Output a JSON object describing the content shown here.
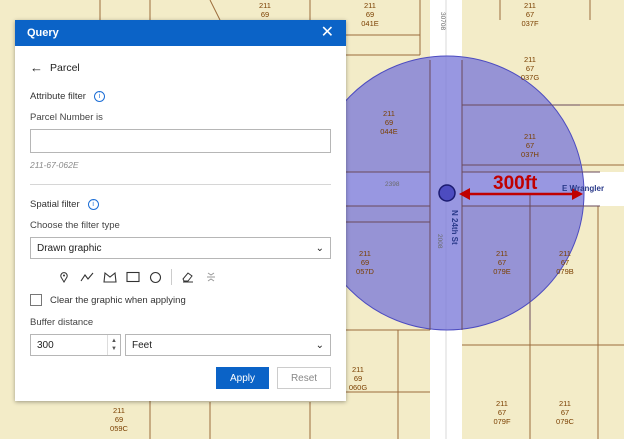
{
  "panel": {
    "title": "Query",
    "back_label": "Parcel",
    "attribute_filter": "Attribute filter",
    "parcel_number_label": "Parcel Number is",
    "parcel_number_value": "",
    "parcel_hint": "211-67-062E",
    "spatial_filter": "Spatial filter",
    "filter_type_label": "Choose the filter type",
    "filter_type_value": "Drawn graphic",
    "clear_label": "Clear the graphic when applying",
    "buffer_label": "Buffer distance",
    "buffer_value": "300",
    "buffer_unit": "Feet",
    "apply_label": "Apply",
    "reset_label": "Reset"
  },
  "draw_tools": [
    "point-icon",
    "polyline-icon",
    "freehand-polygon-icon",
    "rectangle-icon",
    "circle-icon",
    "eraser-icon",
    "collapse-icon"
  ],
  "map": {
    "distance_label": "300ft",
    "streets": {
      "vertical": "N 24th St",
      "horizontal": "E Wrangler",
      "number_top": "30708",
      "number_mid": "2398",
      "number_side": "2008"
    },
    "parcels": [
      {
        "a": "211",
        "b": "69",
        "c": ""
      },
      {
        "a": "211",
        "b": "69",
        "c": "041E"
      },
      {
        "a": "211",
        "b": "67",
        "c": "037F"
      },
      {
        "a": "211",
        "b": "67",
        "c": "037G"
      },
      {
        "a": "211",
        "b": "69",
        "c": "044E"
      },
      {
        "a": "211",
        "b": "67",
        "c": "037H"
      },
      {
        "a": "211",
        "b": "69",
        "c": "057D"
      },
      {
        "a": "211",
        "b": "67",
        "c": "079E"
      },
      {
        "a": "211",
        "b": "67",
        "c": "079B"
      },
      {
        "a": "211",
        "b": "69",
        "c": "060G"
      },
      {
        "a": "211",
        "b": "69",
        "c": "059C"
      },
      {
        "a": "211",
        "b": "67",
        "c": "079F"
      },
      {
        "a": "211",
        "b": "67",
        "c": "079C"
      }
    ],
    "colors": {
      "parcel_fill": "#f3ecc8",
      "parcel_line": "#9b6b3c",
      "buffer_fill": "#7b7ad8",
      "street": "#ffffff",
      "arrow": "#c00000"
    }
  }
}
